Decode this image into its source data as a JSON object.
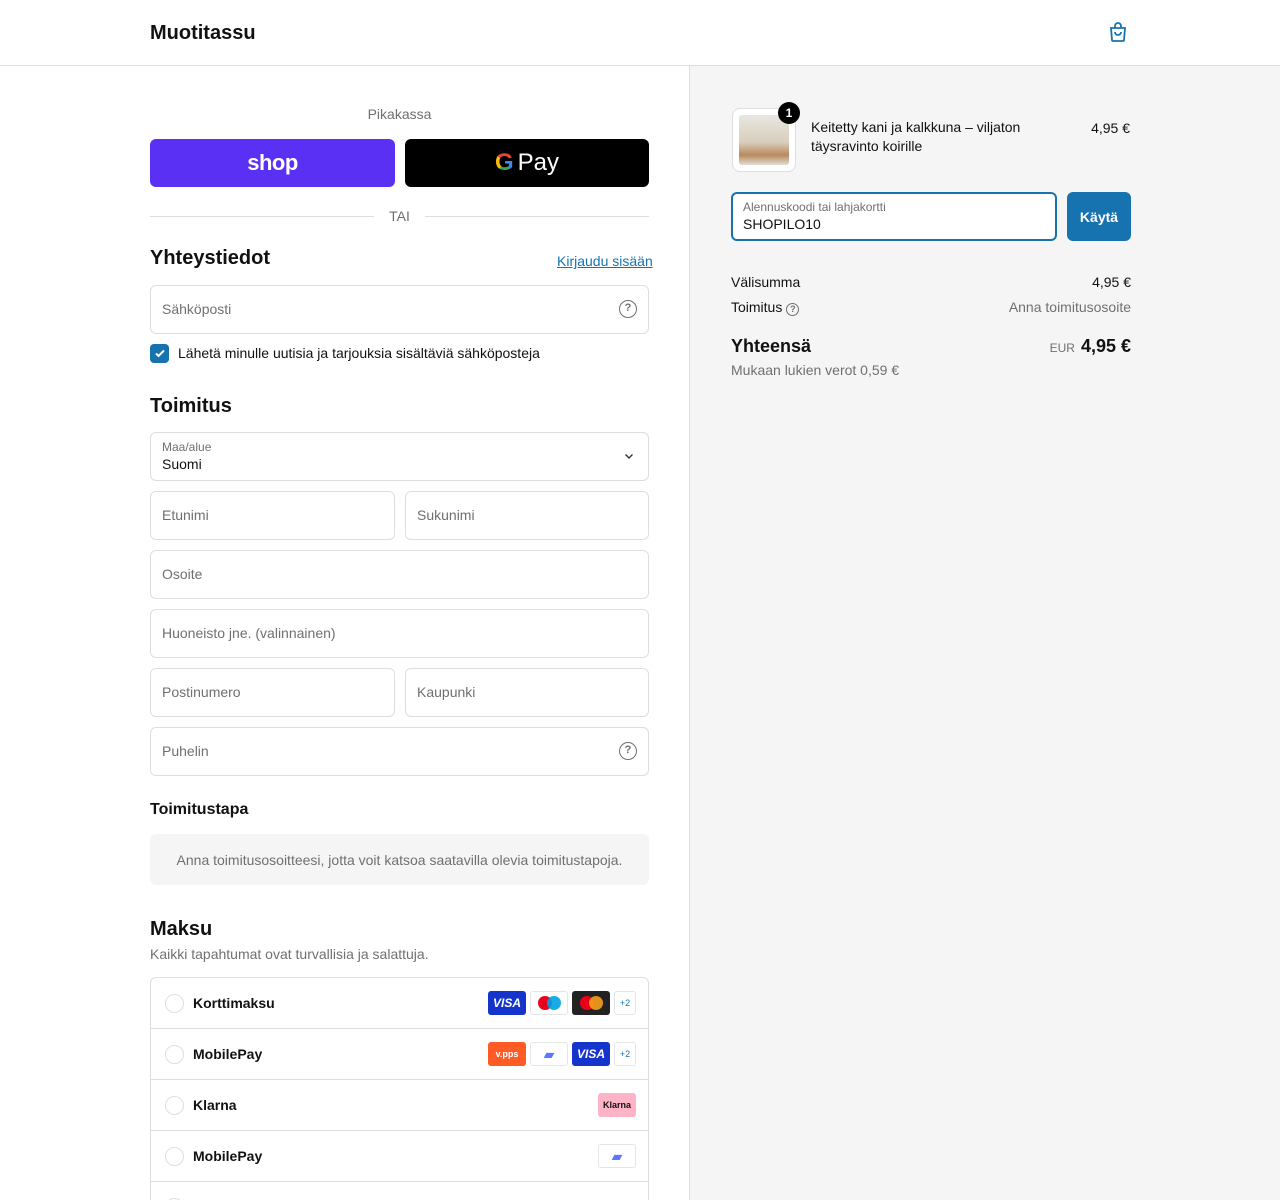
{
  "header": {
    "brand": "Muotitassu",
    "cart_icon": "shopping-bag-icon"
  },
  "express": {
    "title": "Pikakassa",
    "shop_label": "shop",
    "gpay_g": "G",
    "gpay_label": "Pay",
    "or_label": "TAI"
  },
  "contact": {
    "heading": "Yhteystiedot",
    "login_link": "Kirjaudu sisään",
    "email_placeholder": "Sähköposti",
    "newsletter_label": "Lähetä minulle uutisia ja tarjouksia sisältäviä sähköposteja",
    "newsletter_checked": true
  },
  "delivery": {
    "heading": "Toimitus",
    "country_label": "Maa/alue",
    "country_value": "Suomi",
    "first_name": "Etunimi",
    "last_name": "Sukunimi",
    "address": "Osoite",
    "apartment": "Huoneisto jne. (valinnainen)",
    "postal": "Postinumero",
    "city": "Kaupunki",
    "phone": "Puhelin"
  },
  "shipping_method": {
    "heading": "Toimitustapa",
    "info": "Anna toimitusosoitteesi, jotta voit katsoa saatavilla olevia toimitustapoja."
  },
  "payment": {
    "heading": "Maksu",
    "subtitle": "Kaikki tapahtumat ovat turvallisia ja salattuja.",
    "methods": [
      {
        "name": "Korttimaksu",
        "badges": [
          "VISA",
          "maestro",
          "mastercard",
          "+2"
        ]
      },
      {
        "name": "MobilePay",
        "badges": [
          "vipps",
          "mobilepay",
          "VISA",
          "+2"
        ]
      },
      {
        "name": "Klarna",
        "badges": [
          "Klarna"
        ]
      },
      {
        "name": "MobilePay",
        "badges": [
          "mobilepay"
        ]
      }
    ],
    "more_badge": "+2",
    "visa": "VISA",
    "vipps": "v.pps",
    "klarna": "Klarna"
  },
  "summary": {
    "item": {
      "name": "Keitetty kani ja kalkkuna – viljaton täysravinto koirille",
      "price": "4,95 €",
      "quantity": "1"
    },
    "discount": {
      "label": "Alennuskoodi tai lahjakortti",
      "value": "SHOPILO10",
      "apply_label": "Käytä"
    },
    "subtotal_label": "Välisumma",
    "subtotal_value": "4,95 €",
    "shipping_label": "Toimitus",
    "shipping_value": "Anna toimitusosoite",
    "total_label": "Yhteensä",
    "total_currency": "EUR",
    "total_value": "4,95 €",
    "tax_note": "Mukaan lukien verot 0,59 €"
  },
  "colors": {
    "shop_purple": "#5a31f4",
    "link_blue": "#1773b0",
    "summary_bg": "#f5f5f5"
  }
}
